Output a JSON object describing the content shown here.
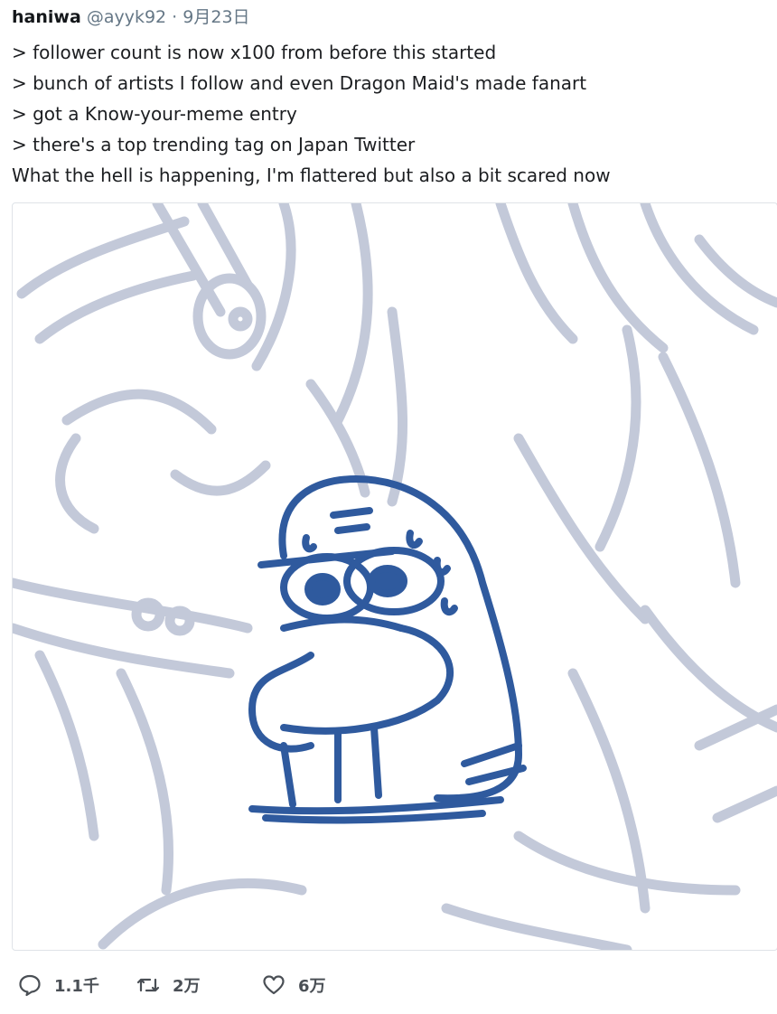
{
  "tweet": {
    "author_name": "haniwa",
    "handle": "@ayyk92",
    "separator": "·",
    "date": "9月23日",
    "lines": [
      "> follower count is now x100 from before this started",
      "> bunch of artists I follow and even Dragon Maid's made fanart",
      "> got a Know-your-meme entry",
      "> there's a top trending tag on Japan Twitter",
      "What the hell is happening, I'm flattered but also a bit scared now"
    ]
  },
  "media": {
    "icon": "drawing-image",
    "colors": {
      "sketch": "#c3c9d9",
      "figure": "#2f5a9e",
      "background": "#ffffff"
    }
  },
  "actions": {
    "reply": {
      "icon": "reply-icon",
      "count": "1.1千"
    },
    "retweet": {
      "icon": "retweet-icon",
      "count": "2万"
    },
    "like": {
      "icon": "heart-icon",
      "count": "6万"
    }
  }
}
